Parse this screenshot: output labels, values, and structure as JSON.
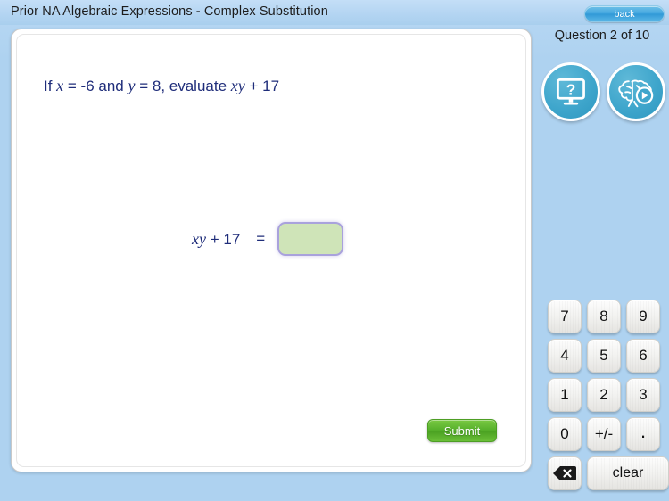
{
  "header": {
    "title": "Prior NA Algebraic Expressions - Complex Substitution",
    "back_label": "back",
    "accent_blue": "#2f98d6"
  },
  "status": {
    "question_counter": "Question 2 of 10"
  },
  "tools": [
    {
      "name": "help-icon",
      "label": "?"
    },
    {
      "name": "brain-video-icon",
      "label": ""
    }
  ],
  "question": {
    "prefix": "If ",
    "var_x": "x",
    "given_x": " = -6 and ",
    "var_y": "y",
    "given_y": " = 8, evaluate ",
    "expr_var": "xy",
    "expr_tail": " + 17"
  },
  "equation": {
    "expr_var": "xy",
    "expr_tail": " + 17",
    "equals": "=",
    "answer_value": "",
    "answer_placeholder": "",
    "answer_fill": "#cfe4b8",
    "answer_border": "#a9a2dc"
  },
  "actions": {
    "submit_label": "Submit",
    "submit_color": "#56b02b"
  },
  "keypad": {
    "keys": [
      {
        "label": "7",
        "name": "key-7"
      },
      {
        "label": "8",
        "name": "key-8"
      },
      {
        "label": "9",
        "name": "key-9"
      },
      {
        "label": "4",
        "name": "key-4"
      },
      {
        "label": "5",
        "name": "key-5"
      },
      {
        "label": "6",
        "name": "key-6"
      },
      {
        "label": "1",
        "name": "key-1"
      },
      {
        "label": "2",
        "name": "key-2"
      },
      {
        "label": "3",
        "name": "key-3"
      },
      {
        "label": "0",
        "name": "key-0"
      },
      {
        "label": "+/-",
        "name": "key-sign"
      },
      {
        "label": ".",
        "name": "key-decimal"
      }
    ],
    "backspace_name": "backspace-icon",
    "clear_label": "clear"
  }
}
